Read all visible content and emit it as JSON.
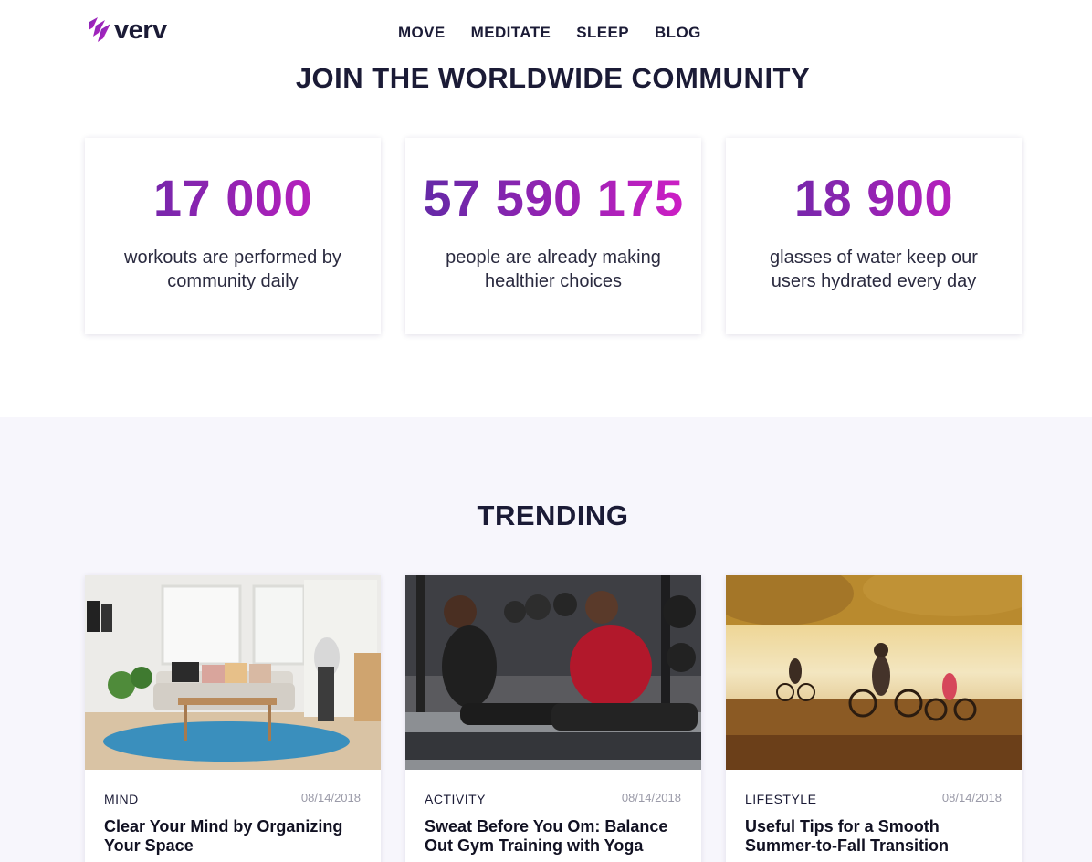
{
  "brand": {
    "name": "verv"
  },
  "nav": {
    "items": [
      "MOVE",
      "MEDITATE",
      "SLEEP",
      "BLOG"
    ]
  },
  "community": {
    "title": "JOIN THE WORLDWIDE COMMUNITY",
    "stats": [
      {
        "value": "17 000",
        "description": "workouts are performed by community daily"
      },
      {
        "value": "57 590 175",
        "description": "people are already making healthier choices"
      },
      {
        "value": "18 900",
        "description": "glasses of water keep our users hydrated every day"
      }
    ]
  },
  "trending": {
    "title": "TRENDING",
    "articles": [
      {
        "category": "MIND",
        "date": "08/14/2018",
        "title": "Clear Your Mind by Organizing Your Space",
        "image": "living-room-photo"
      },
      {
        "category": "ACTIVITY",
        "date": "08/14/2018",
        "title": "Sweat Before You Om: Balance Out Gym Training with Yoga",
        "image": "gym-yoga-photo"
      },
      {
        "category": "LIFESTYLE",
        "date": "08/14/2018",
        "title": "Useful Tips for a Smooth Summer-to-Fall Transition",
        "image": "autumn-cycling-photo"
      }
    ]
  },
  "colors": {
    "brand_gradient_start": "#5e2aa5",
    "brand_gradient_end": "#d51ec7",
    "heading": "#1b1b36",
    "section_bg": "#f7f6fc"
  }
}
